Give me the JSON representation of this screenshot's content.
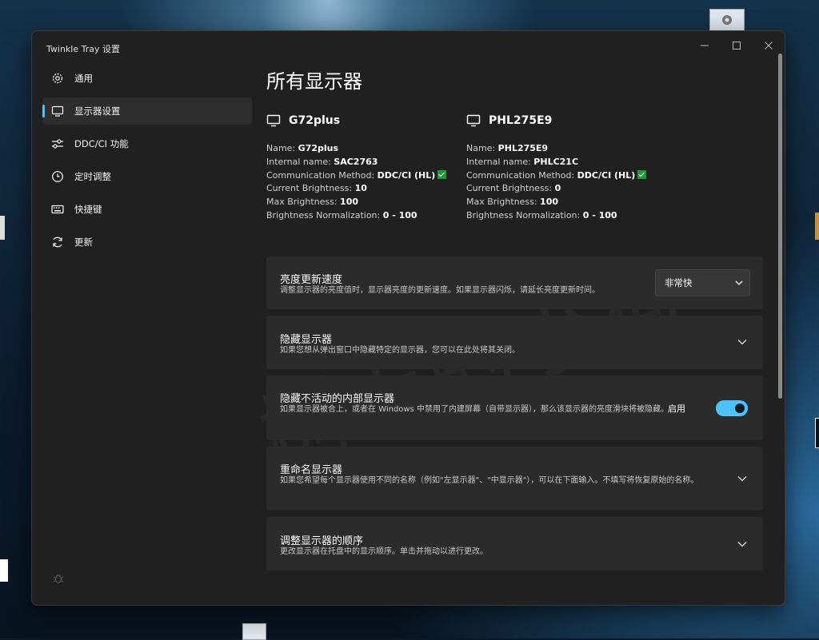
{
  "window": {
    "title": "Twinkle Tray 设置"
  },
  "sidebar": {
    "items": [
      {
        "label": "通用",
        "icon": "gear-icon"
      },
      {
        "label": "显示器设置",
        "icon": "monitor-icon",
        "active": true
      },
      {
        "label": "DDC/CI 功能",
        "icon": "sliders-icon"
      },
      {
        "label": "定时调整",
        "icon": "clock-icon"
      },
      {
        "label": "快捷键",
        "icon": "keyboard-icon"
      },
      {
        "label": "更新",
        "icon": "refresh-icon"
      }
    ],
    "footer_icon": "bug-icon"
  },
  "main": {
    "title": "所有显示器",
    "monitors": [
      {
        "name": "G72plus",
        "info": {
          "name_label": "Name:",
          "name_value": "G72plus",
          "internal_label": "Internal name:",
          "internal_value": "SAC2763",
          "comm_label": "Communication Method:",
          "comm_value": "DDC/CI (HL)",
          "current_label": "Current Brightness:",
          "current_value": "10",
          "max_label": "Max Brightness:",
          "max_value": "100",
          "norm_label": "Brightness Normalization:",
          "norm_value": "0 - 100"
        }
      },
      {
        "name": "PHL275E9",
        "info": {
          "name_label": "Name:",
          "name_value": "PHL275E9",
          "internal_label": "Internal name:",
          "internal_value": "PHLC21C",
          "comm_label": "Communication Method:",
          "comm_value": "DDC/CI (HL)",
          "current_label": "Current Brightness:",
          "current_value": "0",
          "max_label": "Max Brightness:",
          "max_value": "100",
          "norm_label": "Brightness Normalization:",
          "norm_value": "0 - 100"
        }
      }
    ],
    "cards": {
      "update_rate": {
        "title": "亮度更新速度",
        "desc": "调整显示器的亮度值时，显示器亮度的更新速度。如果显示器闪烁，请延长亮度更新时间。",
        "select_value": "非常快"
      },
      "hide_monitors": {
        "title": "隐藏显示器",
        "desc": "如果您想从弹出窗口中隐藏特定的显示器，您可以在此处将其关闭。"
      },
      "hide_internal": {
        "title": "隐藏不活动的内部显示器",
        "desc": "如果显示器被合上，或者在 Windows 中禁用了内建屏幕（自带显示器），那么该显示器的亮度滑块将被隐藏。",
        "toggle_label": "启用",
        "toggle_on": true
      },
      "rename": {
        "title": "重命名显示器",
        "desc": "如果您希望每个显示器使用不同的名称（例如\"左显示器\"、\"中显示器\"），可以在下面输入。不填写将恢复原始的名称。"
      },
      "reorder": {
        "title": "调整显示器的顺序",
        "desc": "更改显示器在托盘中的显示顺序。单击并拖动以进行更改。"
      }
    }
  },
  "colors": {
    "accent": "#4cc2ff",
    "window_bg": "#202020",
    "card_bg": "#2b2b2b",
    "ok": "#1d9b30"
  }
}
